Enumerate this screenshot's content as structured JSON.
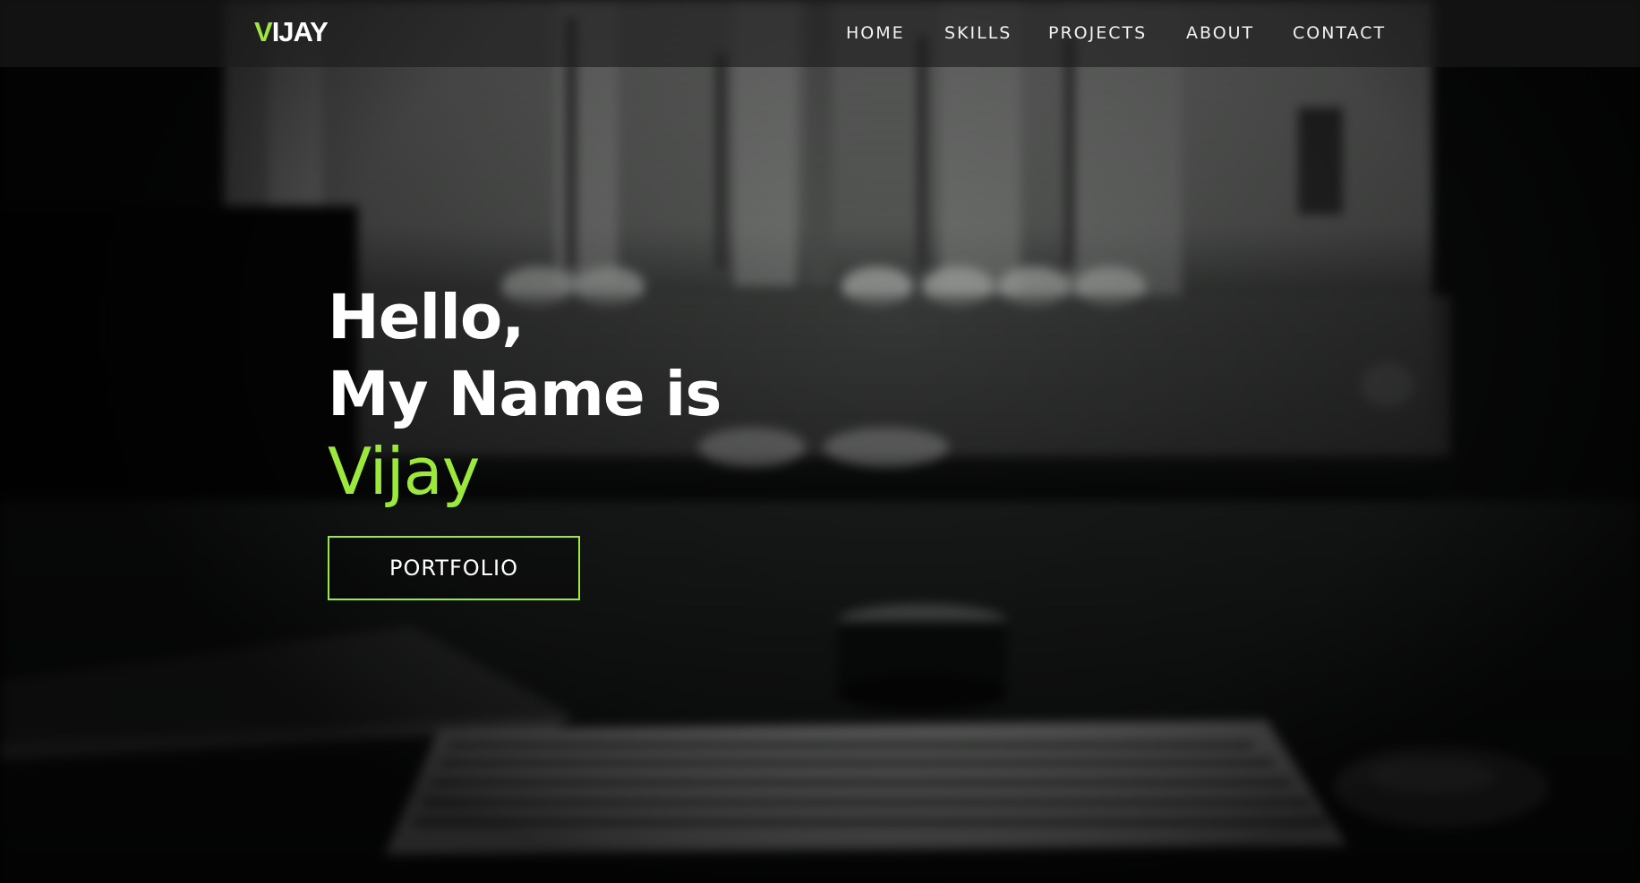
{
  "brand": {
    "first_letter": "V",
    "rest": "IJAY"
  },
  "nav": {
    "items": [
      {
        "label": "HOME"
      },
      {
        "label": "SKILLS"
      },
      {
        "label": "PROJECTS"
      },
      {
        "label": "ABOUT"
      },
      {
        "label": "CONTACT"
      }
    ]
  },
  "hero": {
    "line1": "Hello,",
    "line2": "My Name is",
    "name": "Vijay",
    "button_label": "PORTFOLIO"
  },
  "colors": {
    "accent": "#9de83c",
    "text": "#ffffff",
    "navbar_bg": "rgba(28,28,28,0.62)"
  },
  "background": {
    "description_icon": "desk-keyboard-background-image"
  }
}
